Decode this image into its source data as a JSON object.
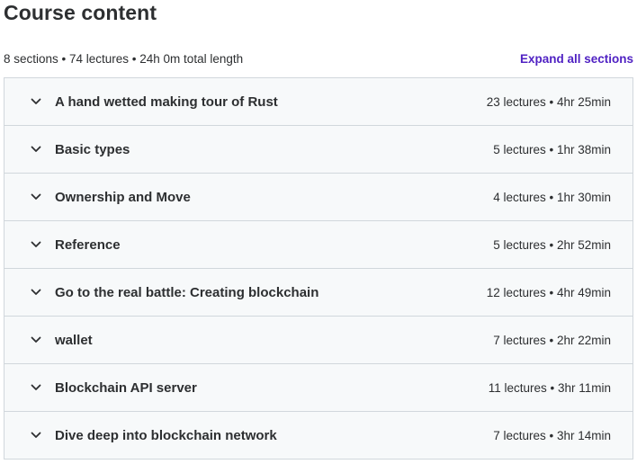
{
  "header": {
    "title": "Course content",
    "summary": "8 sections • 74 lectures • 24h 0m total length",
    "expand_all_label": "Expand all sections"
  },
  "sections": [
    {
      "title": "A hand wetted making tour of Rust",
      "meta": "23 lectures • 4hr 25min"
    },
    {
      "title": "Basic types",
      "meta": "5 lectures • 1hr 38min"
    },
    {
      "title": "Ownership and Move",
      "meta": "4 lectures • 1hr 30min"
    },
    {
      "title": "Reference",
      "meta": "5 lectures • 2hr 52min"
    },
    {
      "title": "Go to the real battle: Creating blockchain",
      "meta": "12 lectures • 4hr 49min"
    },
    {
      "title": "wallet",
      "meta": "7 lectures • 2hr 22min"
    },
    {
      "title": "Blockchain API server",
      "meta": "11 lectures • 3hr 11min"
    },
    {
      "title": "Dive deep into blockchain network",
      "meta": "7 lectures • 3hr 14min"
    }
  ],
  "icons": {
    "section_toggle": "chevron-down-icon"
  },
  "colors": {
    "accent": "#5022c3",
    "section_bg": "#f7f9fa",
    "border": "#d1d7dc",
    "text": "#2d2f31"
  }
}
